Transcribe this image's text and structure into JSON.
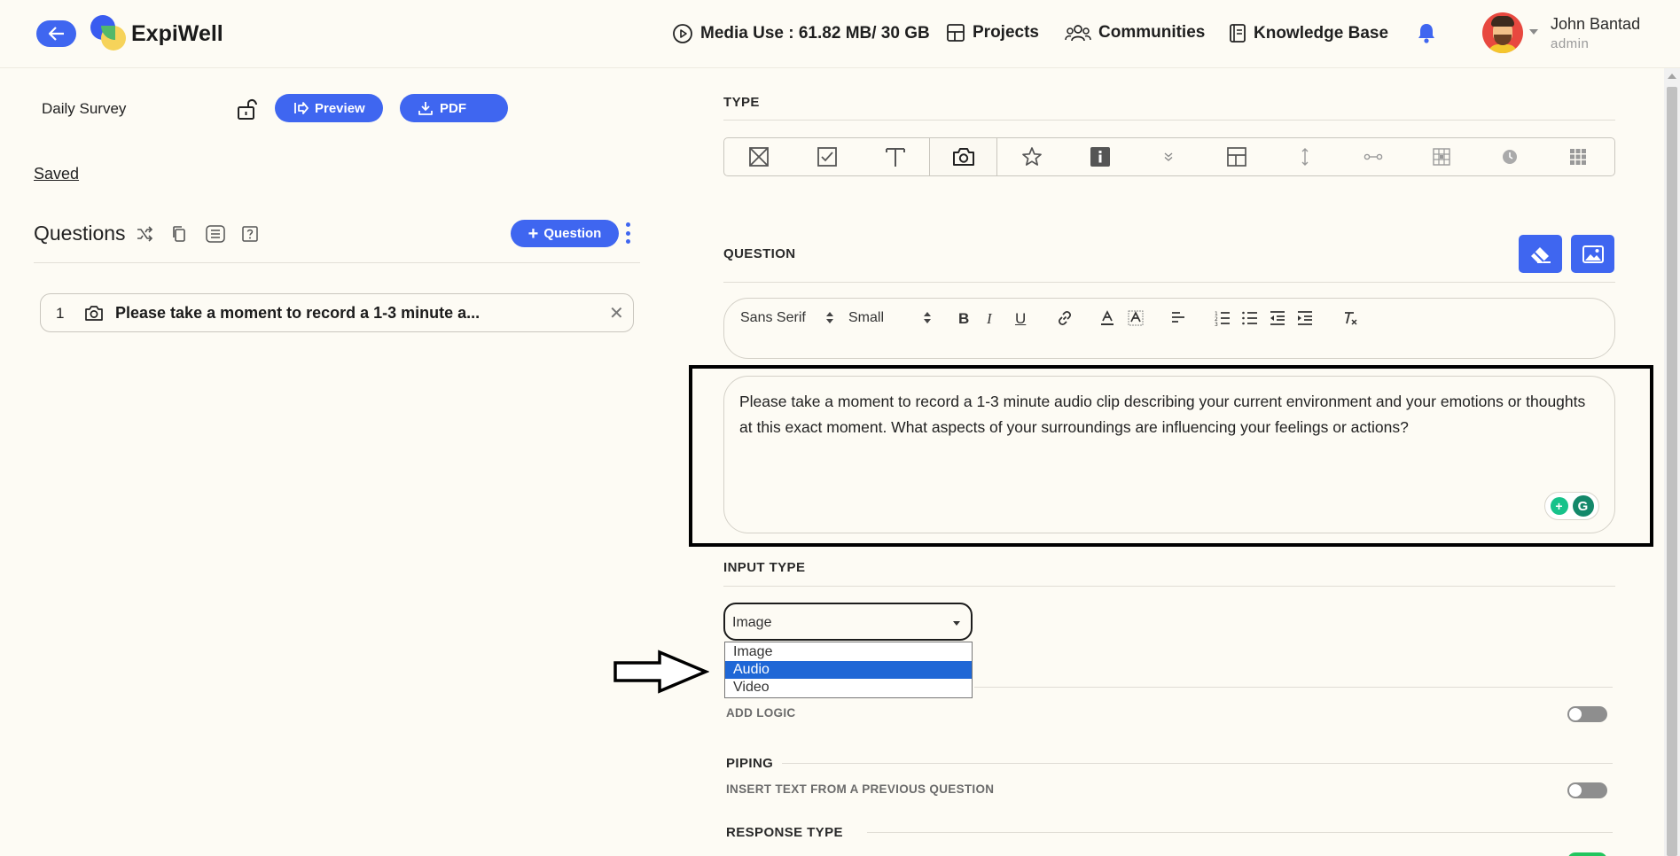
{
  "header": {
    "brand": "ExpiWell",
    "media_use": "Media Use : 61.82 MB/ 30 GB",
    "nav": {
      "projects": "Projects",
      "communities": "Communities",
      "knowledge_base": "Knowledge Base"
    },
    "user": {
      "name": "John Bantad",
      "role": "admin"
    }
  },
  "left": {
    "survey_title": "Daily Survey",
    "preview_label": "Preview",
    "pdf_label": "PDF",
    "saved_label": "Saved",
    "questions_title": "Questions",
    "add_question_label": "Question",
    "questions": [
      {
        "number": "1",
        "text": "Please take a moment to record a 1-3 minute a...",
        "icon": "camera-icon"
      }
    ]
  },
  "right": {
    "type_label": "TYPE",
    "type_icons": [
      "multiple-choice-icon",
      "checkbox-icon",
      "text-icon",
      "camera-icon",
      "star-icon",
      "info-icon",
      "dropdown-chevron-icon",
      "grid-layout-icon",
      "vertical-slider-icon",
      "horizontal-slider-icon",
      "matrix-icon",
      "clock-icon",
      "keypad-icon"
    ],
    "active_type": "camera-icon",
    "question_label": "QUESTION",
    "toolbar": {
      "font": "Sans Serif",
      "size": "Small"
    },
    "question_text": "Please take a moment to record a 1-3 minute audio clip describing your current environment and your emotions or thoughts at this exact moment. What aspects of your surroundings are influencing your feelings or actions?",
    "input_type_label": "INPUT TYPE",
    "input_type_value": "Image",
    "input_type_options": [
      "Image",
      "Audio",
      "Video"
    ],
    "input_type_highlighted": "Audio",
    "add_logic_label": "ADD LOGIC",
    "piping_label": "PIPING",
    "insert_text_label": "INSERT TEXT FROM A PREVIOUS QUESTION",
    "response_type_label": "RESPONSE TYPE"
  },
  "colors": {
    "accent": "#3f66f0",
    "background": "#fdfbf4",
    "selected_option": "#1f67d6",
    "toggle_on": "#22c55e"
  }
}
